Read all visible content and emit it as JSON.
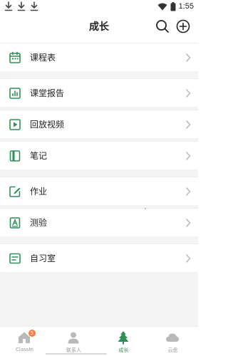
{
  "status_bar": {
    "time": "1:55",
    "icons": [
      "download-icon",
      "download-icon",
      "download-icon",
      "wifi-icon",
      "battery-icon"
    ]
  },
  "header": {
    "title": "成长",
    "search_icon": "search-icon",
    "add_icon": "add-circle-icon"
  },
  "menu": {
    "items": [
      {
        "label": "课程表",
        "icon": "calendar-icon"
      },
      {
        "label": "课堂报告",
        "icon": "report-chart-icon"
      },
      {
        "label": "回放视频",
        "icon": "play-video-icon"
      },
      {
        "label": "笔记",
        "icon": "notebook-icon"
      },
      {
        "label": "作业",
        "icon": "edit-homework-icon"
      },
      {
        "label": "测验",
        "icon": "quiz-icon"
      },
      {
        "label": "自习室",
        "icon": "study-room-icon"
      }
    ]
  },
  "tabbar": {
    "tabs": [
      {
        "label": "ClassIn",
        "icon": "home-icon",
        "badge": "5",
        "active": false
      },
      {
        "label": "联系人",
        "icon": "contacts-icon",
        "active": false
      },
      {
        "label": "成长",
        "icon": "tree-icon",
        "active": true
      },
      {
        "label": "云盘",
        "icon": "cloud-icon",
        "active": false
      }
    ]
  },
  "colors": {
    "accent": "#2f8f57",
    "background": "#f4f4f4",
    "text": "#222222",
    "muted": "#9a9a9a",
    "badge": "#ff7a45"
  }
}
